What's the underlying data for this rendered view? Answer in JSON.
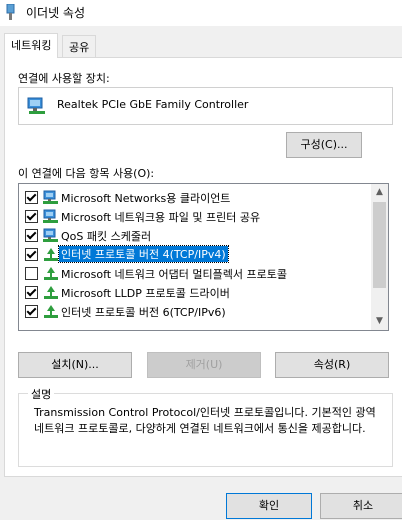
{
  "window": {
    "title": "이더넷 속성",
    "icon": "ethernet-icon"
  },
  "tabs": [
    {
      "label": "네트워킹",
      "active": true
    },
    {
      "label": "공유",
      "active": false
    }
  ],
  "connect_using": {
    "label": "연결에 사용할 장치:",
    "device": "Realtek PCIe GbE Family Controller",
    "configure_button": "구성(C)..."
  },
  "items_section": {
    "label": "이 연결에 다음 항목 사용(O):",
    "items": [
      {
        "label": "Microsoft Networks용 클라이언트",
        "checked": true,
        "icon": "network-client-icon",
        "selected": false
      },
      {
        "label": "Microsoft 네트워크용 파일 및 프린터 공유",
        "checked": true,
        "icon": "network-client-icon",
        "selected": false
      },
      {
        "label": "QoS 패킷 스케줄러",
        "checked": true,
        "icon": "network-client-icon",
        "selected": false
      },
      {
        "label": "인터넷 프로토콜 버전 4(TCP/IPv4)",
        "checked": true,
        "icon": "protocol-icon",
        "selected": true
      },
      {
        "label": "Microsoft 네트워크 어댑터 멀티플렉서 프로토콜",
        "checked": false,
        "icon": "protocol-icon",
        "selected": false
      },
      {
        "label": "Microsoft LLDP 프로토콜 드라이버",
        "checked": true,
        "icon": "protocol-icon",
        "selected": false
      },
      {
        "label": "인터넷 프로토콜 버전 6(TCP/IPv6)",
        "checked": true,
        "icon": "protocol-icon",
        "selected": false
      }
    ]
  },
  "buttons": {
    "install": "설치(N)...",
    "uninstall": "제거(U)",
    "properties": "속성(R)",
    "ok": "확인",
    "cancel": "취소"
  },
  "description": {
    "title": "설명",
    "text": "Transmission Control Protocol/인터넷 프로토콜입니다. 기본적인 광역 네트워크 프로토콜로, 다양하게 연결된 네트워크에서 통신을 제공합니다."
  }
}
